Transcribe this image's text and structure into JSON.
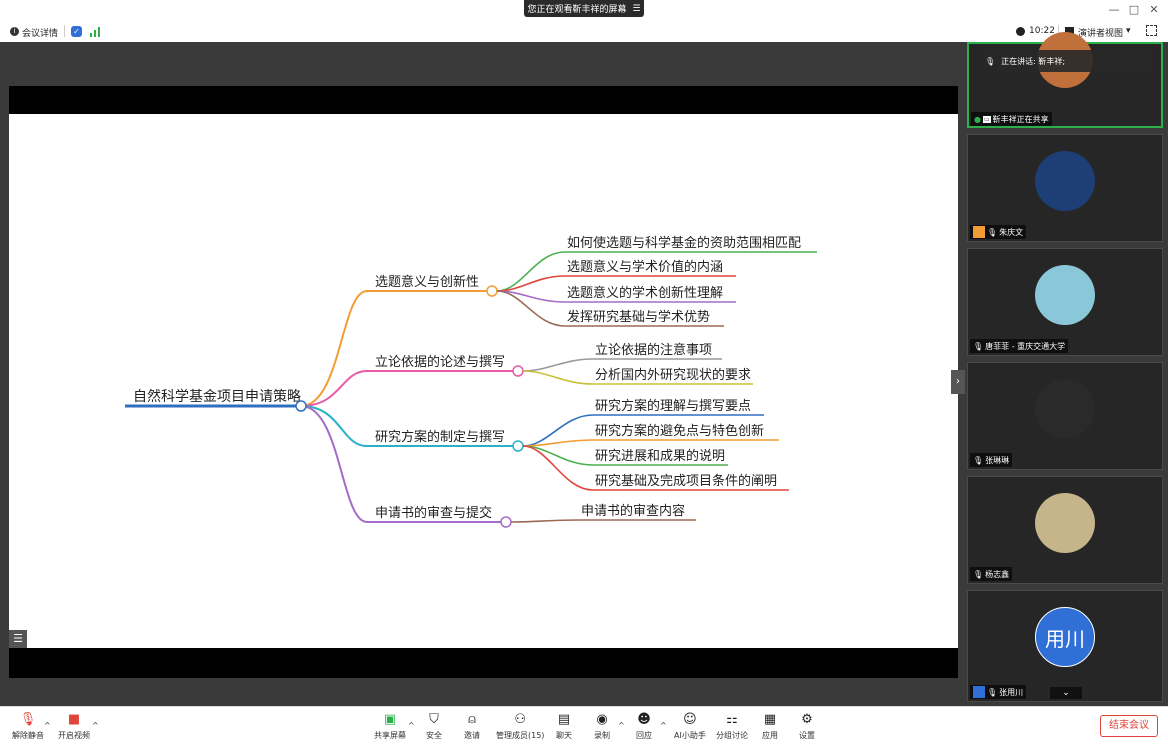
{
  "banner": {
    "text": "您正在观看靳丰祥的屏幕",
    "menu_glyph": "☰"
  },
  "window": {
    "min": "—",
    "max": "□",
    "close": "✕"
  },
  "infobar": {
    "meeting_info": "会议详情",
    "time": "10:22",
    "view": "演讲者视图",
    "view_caret": "▾"
  },
  "mindmap": {
    "root": "自然科学基金项目申请策略",
    "branches": [
      {
        "label": "选题意义与创新性",
        "color": "#f39c34",
        "children": [
          {
            "label": "如何使选题与科学基金的资助范围相匹配",
            "color": "#4cb050"
          },
          {
            "label": "选题意义与学术价值的内涵",
            "color": "#e0453a"
          },
          {
            "label": "选题意义的学术创新性理解",
            "color": "#a56cc9"
          },
          {
            "label": "发挥研究基础与学术优势",
            "color": "#9b6a55"
          }
        ]
      },
      {
        "label": "立论依据的论述与撰写",
        "color": "#e85aa8",
        "children": [
          {
            "label": "立论依据的注意事项",
            "color": "#9a9a9a"
          },
          {
            "label": "分析国内外研究现状的要求",
            "color": "#c9c13a"
          }
        ]
      },
      {
        "label": "研究方案的制定与撰写",
        "color": "#2bb0c9",
        "children": [
          {
            "label": "研究方案的理解与撰写要点",
            "color": "#2f6fbf"
          },
          {
            "label": "研究方案的避免点与特色创新",
            "color": "#f39c34"
          },
          {
            "label": "研究进展和成果的说明",
            "color": "#4cb050"
          },
          {
            "label": "研究基础及完成项目条件的阐明",
            "color": "#e0453a"
          }
        ]
      },
      {
        "label": "申请书的审查与提交",
        "color": "#a56cc9",
        "children": [
          {
            "label": "申请书的审查内容",
            "color": "#9b6a55"
          }
        ]
      }
    ]
  },
  "participants": [
    {
      "name": "靳丰祥正在共享",
      "speaking": "正在讲话: 靳丰祥;",
      "avatar_text": "",
      "avatar_color": "#c0703a"
    },
    {
      "name": "朱庆文",
      "avatar_text": "",
      "avatar_color": "#1d3f75"
    },
    {
      "name": "唐菲菲 - 重庆交通大学",
      "avatar_text": "",
      "avatar_color": "#8ac7d8"
    },
    {
      "name": "张琳琳",
      "avatar_text": "",
      "avatar_color": "#2a2a2a"
    },
    {
      "name": "杨志鑫",
      "avatar_text": "",
      "avatar_color": "#c6b48a"
    },
    {
      "name": "张用川",
      "avatar_text": "用川",
      "avatar_color": "#2f6fd6"
    }
  ],
  "toolbar": {
    "mute": "解除静音",
    "video": "开启视频",
    "share": "共享屏幕",
    "security": "安全",
    "invite": "邀请",
    "members": "管理成员(15)",
    "chat": "聊天",
    "record": "录制",
    "react": "回应",
    "ai": "AI小助手",
    "breakout": "分组讨论",
    "apps": "应用",
    "settings": "设置",
    "end": "结束会议"
  }
}
